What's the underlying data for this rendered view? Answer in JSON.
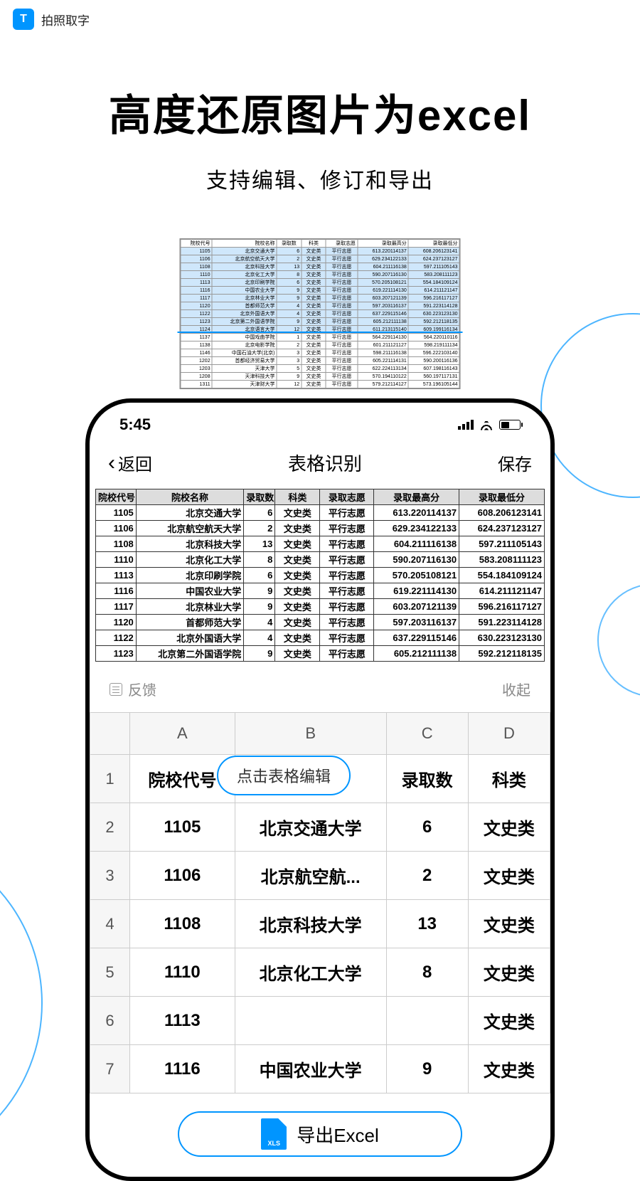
{
  "topbar": {
    "logo_letter": "T",
    "title": "拍照取字"
  },
  "hero": {
    "title": "高度还原图片为excel",
    "subtitle": "支持编辑、修订和导出"
  },
  "phone": {
    "status_time": "5:45",
    "nav_back": "返回",
    "nav_title": "表格识别",
    "nav_save": "保存",
    "feedback": "反馈",
    "collapse": "收起",
    "edit_hint": "点击表格编辑",
    "export_label": "导出Excel",
    "raw_headers": [
      "院校代号",
      "院校名称",
      "录取数",
      "科类",
      "录取志愿",
      "录取最高分",
      "录取最低分"
    ],
    "raw_rows": [
      [
        "1105",
        "北京交通大学",
        "6",
        "文史类",
        "平行志愿",
        "613.220114137",
        "608.206123141"
      ],
      [
        "1106",
        "北京航空航天大学",
        "2",
        "文史类",
        "平行志愿",
        "629.234122133",
        "624.237123127"
      ],
      [
        "1108",
        "北京科技大学",
        "13",
        "文史类",
        "平行志愿",
        "604.211116138",
        "597.211105143"
      ],
      [
        "1110",
        "北京化工大学",
        "8",
        "文史类",
        "平行志愿",
        "590.207116130",
        "583.208111123"
      ],
      [
        "1113",
        "北京印刷学院",
        "6",
        "文史类",
        "平行志愿",
        "570.205108121",
        "554.184109124"
      ],
      [
        "1116",
        "中国农业大学",
        "9",
        "文史类",
        "平行志愿",
        "619.221114130",
        "614.211121147"
      ],
      [
        "1117",
        "北京林业大学",
        "9",
        "文史类",
        "平行志愿",
        "603.207121139",
        "596.216117127"
      ],
      [
        "1120",
        "首都师范大学",
        "4",
        "文史类",
        "平行志愿",
        "597.203116137",
        "591.223114128"
      ],
      [
        "1122",
        "北京外国语大学",
        "4",
        "文史类",
        "平行志愿",
        "637.229115146",
        "630.223123130"
      ],
      [
        "1123",
        "北京第二外国语学院",
        "9",
        "文史类",
        "平行志愿",
        "605.212111138",
        "592.212118135"
      ]
    ],
    "grid_col_headers": [
      "A",
      "B",
      "C",
      "D"
    ],
    "grid_rows": [
      {
        "n": "1",
        "cells": [
          "院校代号",
          "",
          "录取数",
          "科类"
        ]
      },
      {
        "n": "2",
        "cells": [
          "1105",
          "北京交通大学",
          "6",
          "文史类"
        ]
      },
      {
        "n": "3",
        "cells": [
          "1106",
          "北京航空航...",
          "2",
          "文史类"
        ]
      },
      {
        "n": "4",
        "cells": [
          "1108",
          "北京科技大学",
          "13",
          "文史类"
        ]
      },
      {
        "n": "5",
        "cells": [
          "1110",
          "北京化工大学",
          "8",
          "文史类"
        ]
      },
      {
        "n": "6",
        "cells": [
          "1113",
          "",
          "",
          "文史类"
        ]
      },
      {
        "n": "7",
        "cells": [
          "1116",
          "中国农业大学",
          "9",
          "文史类"
        ]
      }
    ]
  },
  "bg_table": {
    "headers": [
      "院校代号",
      "院校名称",
      "录取数",
      "科类",
      "录取志愿",
      "录取最高分",
      "录取最低分"
    ],
    "rows_hl": [
      [
        "1105",
        "北京交通大学",
        "6",
        "文史类",
        "平行志愿",
        "613.220114137",
        "608.206123141"
      ],
      [
        "1106",
        "北京航空航天大学",
        "2",
        "文史类",
        "平行志愿",
        "629.234122133",
        "624.237123127"
      ],
      [
        "1108",
        "北京科技大学",
        "13",
        "文史类",
        "平行志愿",
        "604.211116138",
        "597.211105143"
      ],
      [
        "1110",
        "北京化工大学",
        "8",
        "文史类",
        "平行志愿",
        "590.207116130",
        "583.208111123"
      ],
      [
        "1113",
        "北京印刷学院",
        "6",
        "文史类",
        "平行志愿",
        "570.205108121",
        "554.184109124"
      ],
      [
        "1116",
        "中国农业大学",
        "9",
        "文史类",
        "平行志愿",
        "619.221114130",
        "614.211121147"
      ],
      [
        "1117",
        "北京林业大学",
        "9",
        "文史类",
        "平行志愿",
        "603.207121139",
        "596.216117127"
      ],
      [
        "1120",
        "首都师范大学",
        "4",
        "文史类",
        "平行志愿",
        "597.203116137",
        "591.223114128"
      ],
      [
        "1122",
        "北京外国语大学",
        "4",
        "文史类",
        "平行志愿",
        "637.229115146",
        "630.223123130"
      ],
      [
        "1123",
        "北京第二外国语学院",
        "9",
        "文史类",
        "平行志愿",
        "605.212111138",
        "592.212118135"
      ],
      [
        "1124",
        "北京语言大学",
        "12",
        "文史类",
        "平行志愿",
        "611.213115140",
        "609.199116134"
      ]
    ],
    "rows_plain": [
      [
        "1137",
        "中国戏曲学院",
        "1",
        "文史类",
        "平行志愿",
        "564.229114130",
        "564.220110116"
      ],
      [
        "1138",
        "北京电影学院",
        "2",
        "文史类",
        "平行志愿",
        "601.211121127",
        "598.219111134"
      ],
      [
        "1146",
        "中国石油大学(北京)",
        "3",
        "文史类",
        "平行志愿",
        "598.211116138",
        "596.222103140"
      ],
      [
        "1202",
        "首都经济贸易大学",
        "3",
        "文史类",
        "平行志愿",
        "605.221114131",
        "590.200116136"
      ],
      [
        "1203",
        "天津大学",
        "5",
        "文史类",
        "平行志愿",
        "622.224113134",
        "607.198116143"
      ],
      [
        "1208",
        "天津科技大学",
        "9",
        "文史类",
        "平行志愿",
        "570.194110122",
        "560.197117131"
      ],
      [
        "1311",
        "天津财大学",
        "12",
        "文史类",
        "平行志愿",
        "579.212114127",
        "573.196105144"
      ]
    ]
  }
}
